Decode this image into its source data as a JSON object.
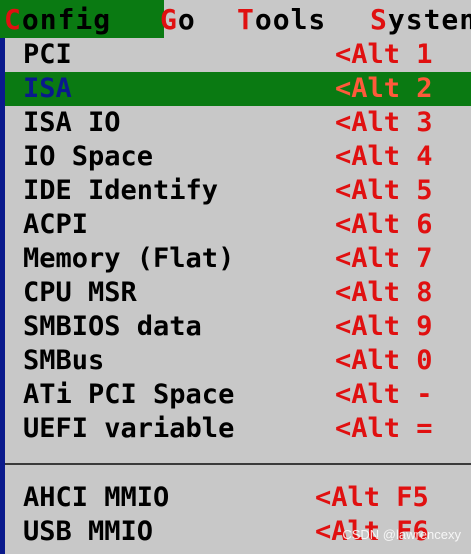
{
  "menubar": {
    "items": [
      {
        "hotkey": "C",
        "rest": "onfig"
      },
      {
        "hotkey": "G",
        "rest": "o"
      },
      {
        "hotkey": "T",
        "rest": "ools"
      },
      {
        "hotkey": "S",
        "rest": "ysten"
      }
    ]
  },
  "dropdown": {
    "items": [
      {
        "label": "PCI",
        "shortcut": "<Alt 1"
      },
      {
        "label": "ISA",
        "shortcut": "<Alt 2"
      },
      {
        "label": "ISA IO",
        "shortcut": "<Alt 3"
      },
      {
        "label": "IO Space",
        "shortcut": "<Alt 4"
      },
      {
        "label": "IDE Identify",
        "shortcut": "<Alt 5"
      },
      {
        "label": "ACPI",
        "shortcut": "<Alt 6"
      },
      {
        "label": "Memory (Flat)",
        "shortcut": "<Alt 7"
      },
      {
        "label": "CPU MSR",
        "shortcut": "<Alt 8"
      },
      {
        "label": "SMBIOS data",
        "shortcut": "<Alt 9"
      },
      {
        "label": "SMBus",
        "shortcut": "<Alt 0"
      },
      {
        "label": "ATi PCI Space",
        "shortcut": "<Alt -"
      },
      {
        "label": "UEFI variable",
        "shortcut": "<Alt ="
      }
    ],
    "extra_items": [
      {
        "label": "AHCI MMIO",
        "shortcut": "<Alt F5"
      },
      {
        "label": "USB MMIO",
        "shortcut": "<Alt F6"
      }
    ],
    "selected_label": "ISA"
  },
  "watermark": "CSDN @lawrencexy",
  "colors": {
    "background": "#0a1a8c",
    "menu_gray": "#c8c8c8",
    "highlight_green": "#0a7a12",
    "hotkey_red": "#e01010"
  }
}
